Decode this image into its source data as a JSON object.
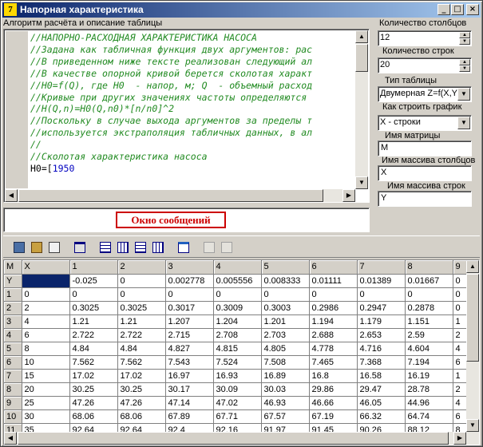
{
  "window": {
    "title": "Напорная характеристика"
  },
  "titlebar_buttons": {
    "minimize": "_",
    "maximize": "□",
    "close": "×"
  },
  "editor": {
    "label": "Алгоритм расчёта и описание таблицы",
    "lines": [
      "//НАПОРНО-РАСХОДНАЯ ХАРАКТЕРИСТИКА НАСОСА",
      "//Задана как табличная функция двух аргументов: рас",
      "//В приведенном ниже тексте реализован следующий ал",
      "//В качестве опорной кривой берется сколотая характ",
      "//H0=f(Q), где H0  - напор, м; Q  - объемный расход",
      "//Кривые при других значениях частоты определяются",
      "//H(Q,n)=H0(Q,n0)*[n/n0]^2",
      "//Поскольку в случае выхода аргументов за пределы т",
      "//используется экстраполяция табличных данных, в ал",
      "//",
      "//Сколотая характеристика насоса"
    ],
    "last_line_code": "H0=[",
    "last_line_num": "1950"
  },
  "message_window": {
    "title": "Окно сообщений"
  },
  "right_panel": {
    "columns_count": {
      "label": "Количество столбцов",
      "value": "12"
    },
    "rows_count": {
      "label": "Количество строк",
      "value": "20"
    },
    "table_type": {
      "label": "Тип таблицы",
      "value": "Двумерная Z=f(X,Y"
    },
    "build_graph": {
      "label": "Как строить график",
      "value": "X - строки"
    },
    "matrix_name": {
      "label": "Имя матрицы",
      "value": "M"
    },
    "columns_array_name": {
      "label": "Имя массива столбцов",
      "value": "X"
    },
    "rows_array_name": {
      "label": "Имя массива строк",
      "value": "Y"
    }
  },
  "toolbar": {
    "icons": [
      "copy-icon",
      "paste-icon",
      "paste-special-icon",
      "table-icon",
      "insert-row-icon",
      "insert-column-icon",
      "delete-row-icon",
      "delete-column-icon",
      "grid-properties-icon",
      "disabled-icon-1",
      "disabled-icon-2"
    ]
  },
  "grid": {
    "header": [
      "M",
      "X",
      "1",
      "2",
      "3",
      "4",
      "5",
      "6",
      "7",
      "8",
      "9"
    ],
    "rows": [
      [
        "Y",
        "",
        "-0.025",
        "0",
        "0.002778",
        "0.005556",
        "0.008333",
        "0.01111",
        "0.01389",
        "0.01667",
        "0"
      ],
      [
        "1",
        "0",
        "0",
        "0",
        "0",
        "0",
        "0",
        "0",
        "0",
        "0",
        "0"
      ],
      [
        "2",
        "2",
        "0.3025",
        "0.3025",
        "0.3017",
        "0.3009",
        "0.3003",
        "0.2986",
        "0.2947",
        "0.2878",
        "0"
      ],
      [
        "3",
        "4",
        "1.21",
        "1.21",
        "1.207",
        "1.204",
        "1.201",
        "1.194",
        "1.179",
        "1.151",
        "1"
      ],
      [
        "4",
        "6",
        "2.722",
        "2.722",
        "2.715",
        "2.708",
        "2.703",
        "2.688",
        "2.653",
        "2.59",
        "2"
      ],
      [
        "5",
        "8",
        "4.84",
        "4.84",
        "4.827",
        "4.815",
        "4.805",
        "4.778",
        "4.716",
        "4.604",
        "4"
      ],
      [
        "6",
        "10",
        "7.562",
        "7.562",
        "7.543",
        "7.524",
        "7.508",
        "7.465",
        "7.368",
        "7.194",
        "6"
      ],
      [
        "7",
        "15",
        "17.02",
        "17.02",
        "16.97",
        "16.93",
        "16.89",
        "16.8",
        "16.58",
        "16.19",
        "1"
      ],
      [
        "8",
        "20",
        "30.25",
        "30.25",
        "30.17",
        "30.09",
        "30.03",
        "29.86",
        "29.47",
        "28.78",
        "2"
      ],
      [
        "9",
        "25",
        "47.26",
        "47.26",
        "47.14",
        "47.02",
        "46.93",
        "46.66",
        "46.05",
        "44.96",
        "4"
      ],
      [
        "10",
        "30",
        "68.06",
        "68.06",
        "67.89",
        "67.71",
        "67.57",
        "67.19",
        "66.32",
        "64.74",
        "6"
      ],
      [
        "11",
        "35",
        "92.64",
        "92.64",
        "92.4",
        "92.16",
        "91.97",
        "91.45",
        "90.26",
        "88.12",
        "8"
      ]
    ]
  }
}
